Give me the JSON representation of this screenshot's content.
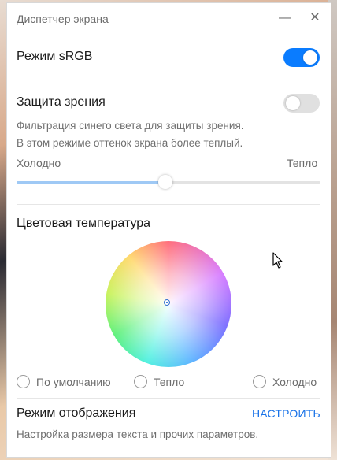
{
  "window": {
    "title": "Диспетчер экрана",
    "minimize_symbol": "—",
    "close_symbol": "✕"
  },
  "srgb": {
    "label": "Режим sRGB",
    "enabled": true
  },
  "eye_protection": {
    "label": "Защита зрения",
    "enabled": false,
    "description_line1": "Фильтрация синего света для защиты зрения.",
    "description_line2": "В этом режиме оттенок экрана более теплый.",
    "slider": {
      "min_label": "Холодно",
      "max_label": "Тепло",
      "value_fraction": 0.49
    }
  },
  "color_temperature": {
    "label": "Цветовая температура",
    "options": [
      {
        "label": "По умолчанию",
        "selected": false
      },
      {
        "label": "Тепло",
        "selected": false
      },
      {
        "label": "Холодно",
        "selected": false
      }
    ]
  },
  "display_mode": {
    "label": "Режим отображения",
    "action_label": "НАСТРОИТЬ",
    "description": "Настройка размера текста и прочих параметров."
  },
  "colors": {
    "accent": "#0a7cff",
    "link": "#1a73e8",
    "slider_fill": "#9fc9f5"
  },
  "icons": {
    "minimize": "minimize-icon",
    "close": "close-icon",
    "cursor": "mouse-cursor-icon"
  }
}
